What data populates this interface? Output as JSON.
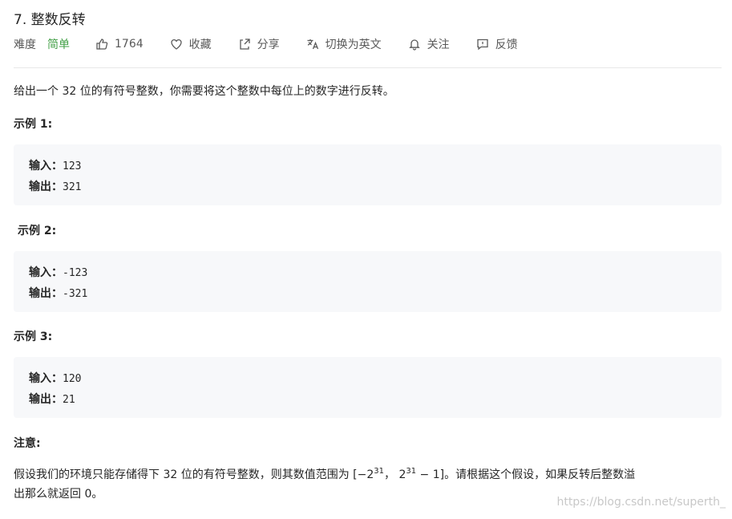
{
  "problem": {
    "title": "7. 整数反转"
  },
  "toolbar": {
    "difficulty_label": "难度",
    "difficulty_value": "简单",
    "likes": "1764",
    "favorite_label": "收藏",
    "share_label": "分享",
    "switch_lang_label": "切换为英文",
    "follow_label": "关注",
    "feedback_label": "反馈"
  },
  "description": "给出一个 32 位的有符号整数，你需要将这个整数中每位上的数字进行反转。",
  "examples": [
    {
      "heading": "示例 1:",
      "input_label": "输入：",
      "input": "123",
      "output_label": "输出：",
      "output": "321"
    },
    {
      "heading": "示例 2:",
      "input_label": "输入：",
      "input": "-123",
      "output_label": "输出：",
      "output": "-321"
    },
    {
      "heading": "示例 3:",
      "input_label": "输入：",
      "input": "120",
      "output_label": "输出：",
      "output": "21"
    }
  ],
  "note": {
    "heading": "注意:",
    "line1_a": "假设我们的环境只能存储得下 32 位的有符号整数，则其数值范围为 [−2",
    "exp1": "31",
    "line1_b": "，  2",
    "exp2": "31",
    "line1_c": " − 1]。请根据这个假设，如果反转后整数溢",
    "line2": "出那么就返回 0。"
  },
  "watermark": "https://blog.csdn.net/superth_"
}
